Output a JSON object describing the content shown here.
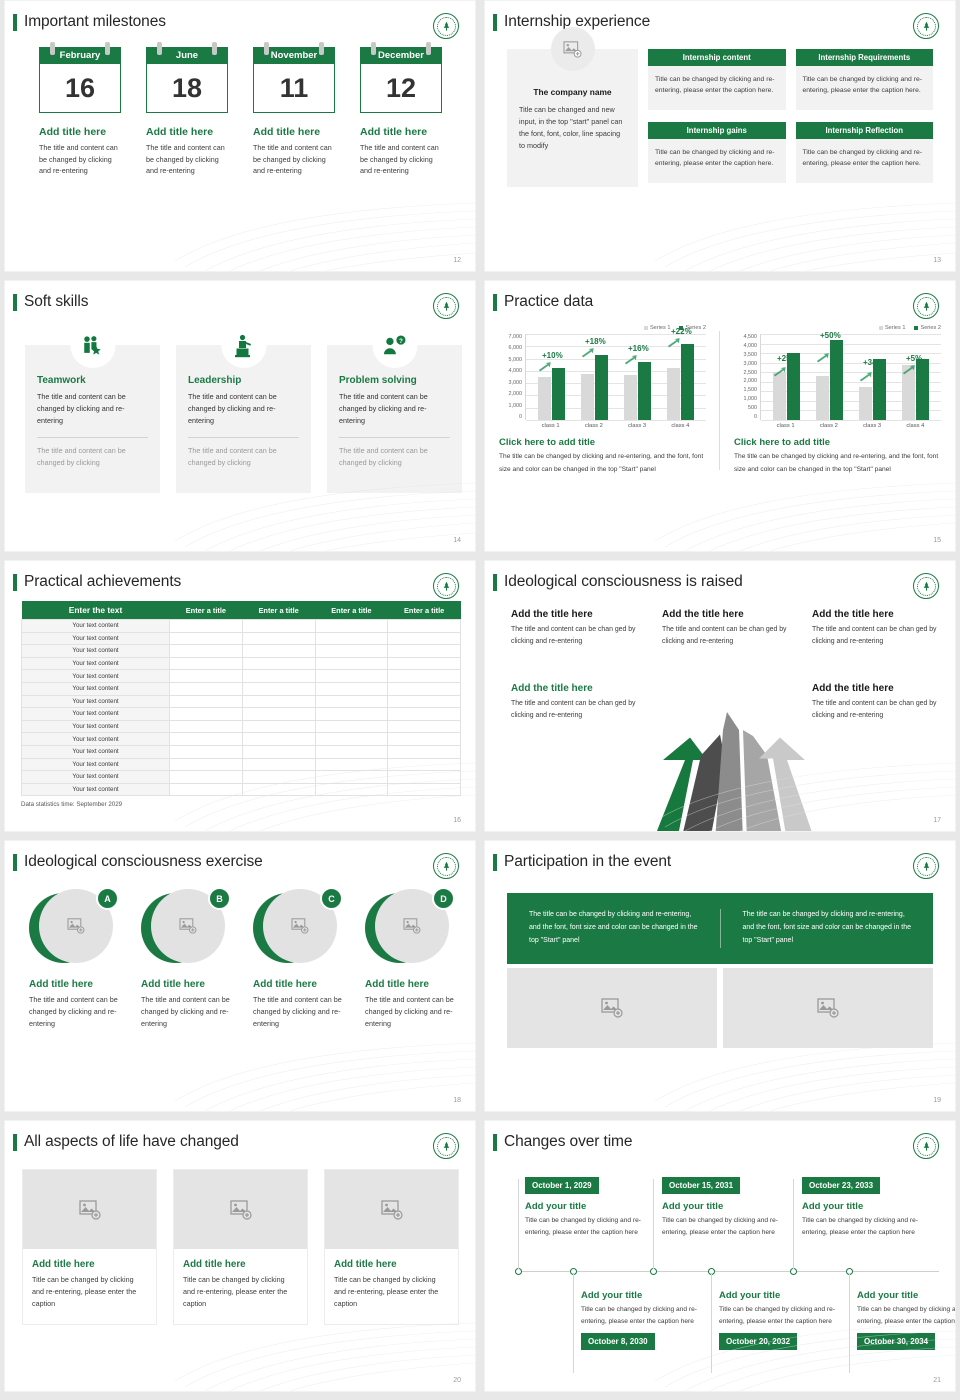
{
  "brand": {
    "green": "#1b7a44",
    "gray": "#d9d9d9",
    "logo_name": "circular-green-seal-logo"
  },
  "slides": [
    {
      "page": "12",
      "title": "Important milestones",
      "calendars": [
        {
          "month": "February",
          "day": "16",
          "title": "Add title here",
          "desc": "The title and content can be changed by clicking and re-entering"
        },
        {
          "month": "June",
          "day": "18",
          "title": "Add title here",
          "desc": "The title and content can be changed by clicking and re-entering"
        },
        {
          "month": "November",
          "day": "11",
          "title": "Add title here",
          "desc": "The title and content can be changed by clicking and re-entering"
        },
        {
          "month": "December",
          "day": "12",
          "title": "Add title here",
          "desc": "The title and content can be changed by clicking and re-entering"
        }
      ]
    },
    {
      "page": "13",
      "title": "Internship experience",
      "company": {
        "name": "The company name",
        "desc": "Title can be changed and new input, in the top \"start\" panel can the font, font, color, line spacing to modify"
      },
      "cards": [
        {
          "head": "Internship content",
          "body": "Title can be changed by clicking and re-entering, please enter the caption here."
        },
        {
          "head": "Internship Requirements",
          "body": "Title can be changed by clicking and re-entering, please enter the caption here."
        },
        {
          "head": "Internship gains",
          "body": "Title can be changed by clicking and re-entering, please enter the caption here."
        },
        {
          "head": "Internship Reflection",
          "body": "Title can be changed by clicking and re-entering, please enter the caption here."
        }
      ]
    },
    {
      "page": "14",
      "title": "Soft skills",
      "skills": [
        {
          "icon": "teamwork-people-star-icon",
          "title": "Teamwork",
          "desc": "The title and content can be changed by clicking and re-entering",
          "desc2": "The title and content can be changed by clicking"
        },
        {
          "icon": "leadership-podium-icon",
          "title": "Leadership",
          "desc": "The title and content can be changed by clicking and re-entering",
          "desc2": "The title and content can be changed by clicking"
        },
        {
          "icon": "problem-solving-question-icon",
          "title": "Problem solving",
          "desc": "The title and content can be changed by clicking and re-entering",
          "desc2": "The title and content can be changed by clicking"
        }
      ]
    },
    {
      "page": "15",
      "title": "Practice data",
      "captions": [
        {
          "title": "Click here to add title",
          "desc": "The title can be changed by clicking and re-entering, and the font, font size and color can be changed in the top \"Start\" panel"
        },
        {
          "title": "Click here to add title",
          "desc": "The title can be changed by clicking and re-entering, and the font, font size and color can be changed in the top \"Start\" panel"
        }
      ]
    },
    {
      "page": "16",
      "title": "Practical achievements",
      "table": {
        "headers": [
          "Enter the text",
          "Enter a title",
          "Enter a title",
          "Enter a title",
          "Enter a title"
        ],
        "cell": "Your text content",
        "rows": 14
      },
      "note": "Data statistics time: September 2029"
    },
    {
      "page": "17",
      "title": "Ideological consciousness is raised",
      "items": [
        {
          "title": "Add the title here",
          "desc": "The title and content can be chan ged by clicking and re-entering",
          "accent": false
        },
        {
          "title": "Add the title here",
          "desc": "The title and content can be chan ged by clicking and re-entering",
          "accent": false
        },
        {
          "title": "Add the title here",
          "desc": "The title and content can be chan ged by clicking and re-entering",
          "accent": false
        },
        {
          "title": "Add the title here",
          "desc": "The title and content can be chan ged by clicking and re-entering",
          "accent": true
        },
        {
          "title": "Add the title here",
          "desc": "The title and content can be chan ged by clicking and re-entering",
          "accent": false
        }
      ]
    },
    {
      "page": "18",
      "title": "Ideological consciousness exercise",
      "items": [
        {
          "badge": "A",
          "title": "Add title here",
          "desc": "The title and content can be changed by clicking and re-entering"
        },
        {
          "badge": "B",
          "title": "Add title here",
          "desc": "The title and content can be changed by clicking and re-entering"
        },
        {
          "badge": "C",
          "title": "Add title here",
          "desc": "The title and content can be changed by clicking and re-entering"
        },
        {
          "badge": "D",
          "title": "Add title here",
          "desc": "The title and content can be changed by clicking and re-entering"
        }
      ]
    },
    {
      "page": "19",
      "title": "Participation in the event",
      "texts": [
        "The title can be changed by clicking and re-entering, and the font, font size and color can be changed in the top \"Start\" panel",
        "The title can be changed by clicking and re-entering, and the font, font size and color can be changed in the top \"Start\" panel"
      ]
    },
    {
      "page": "20",
      "title": "All aspects of life have changed",
      "cards": [
        {
          "title": "Add title here",
          "desc": "Title can be changed by clicking and re-entering, please enter the caption"
        },
        {
          "title": "Add title here",
          "desc": "Title can be changed by clicking and re-entering, please enter the caption"
        },
        {
          "title": "Add title here",
          "desc": "Title can be changed by clicking and re-entering, please enter the caption"
        }
      ]
    },
    {
      "page": "21",
      "title": "Changes over time",
      "events": [
        {
          "date": "October 1, 2029",
          "title": "Add your title",
          "desc": "Title can be changed by clicking and re-entering, please enter the caption here",
          "position": "top"
        },
        {
          "date": "October 8, 2030",
          "title": "Add your title",
          "desc": "Title can be changed by clicking and re-entering, please enter the caption here",
          "position": "bottom"
        },
        {
          "date": "October 15, 2031",
          "title": "Add your title",
          "desc": "Title can be changed by clicking and re-entering, please enter the caption here",
          "position": "top"
        },
        {
          "date": "October 20, 2032",
          "title": "Add your title",
          "desc": "Title can be changed by clicking and re-entering, please enter the caption here",
          "position": "bottom"
        },
        {
          "date": "October 23, 2033",
          "title": "Add your title",
          "desc": "Title can be changed by clicking and re-entering, please enter the caption here",
          "position": "top"
        },
        {
          "date": "October 30, 2034",
          "title": "Add your title",
          "desc": "Title can be changed by clicking and re-entering, please enter the caption here",
          "position": "bottom"
        }
      ]
    }
  ],
  "chart_data": [
    {
      "type": "bar",
      "title": "",
      "categories": [
        "class 1",
        "class 2",
        "class 3",
        "class 4"
      ],
      "series": [
        {
          "name": "Series 1",
          "values": [
            3500,
            3800,
            3650,
            4300
          ],
          "color": "#d9d9d9"
        },
        {
          "name": "Series 2",
          "values": [
            4200,
            5300,
            4750,
            6200
          ],
          "color": "#1b7a44"
        }
      ],
      "annotations": [
        "+10%",
        "+18%",
        "+16%",
        "+22%"
      ],
      "ylim": [
        0,
        7000
      ],
      "yticks": [
        "7,000",
        "6,000",
        "5,000",
        "4,000",
        "3,000",
        "2,000",
        "1,000",
        "0"
      ],
      "xlabel": "",
      "ylabel": "",
      "grid": true,
      "legend": "top-right"
    },
    {
      "type": "bar",
      "title": "",
      "categories": [
        "class 1",
        "class 2",
        "class 3",
        "class 4"
      ],
      "series": [
        {
          "name": "Series 1",
          "values": [
            2500,
            2300,
            1750,
            2900
          ],
          "color": "#d9d9d9"
        },
        {
          "name": "Series 2",
          "values": [
            3500,
            4200,
            3200,
            3200
          ],
          "color": "#1b7a44"
        }
      ],
      "annotations": [
        "+25%",
        "+50%",
        "+34%",
        "+5%"
      ],
      "ylim": [
        0,
        4500
      ],
      "yticks": [
        "4,500",
        "4,000",
        "3,500",
        "3,000",
        "2,500",
        "2,000",
        "1,500",
        "1,000",
        "500",
        "0"
      ],
      "xlabel": "",
      "ylabel": "",
      "grid": true,
      "legend": "top-right"
    }
  ]
}
